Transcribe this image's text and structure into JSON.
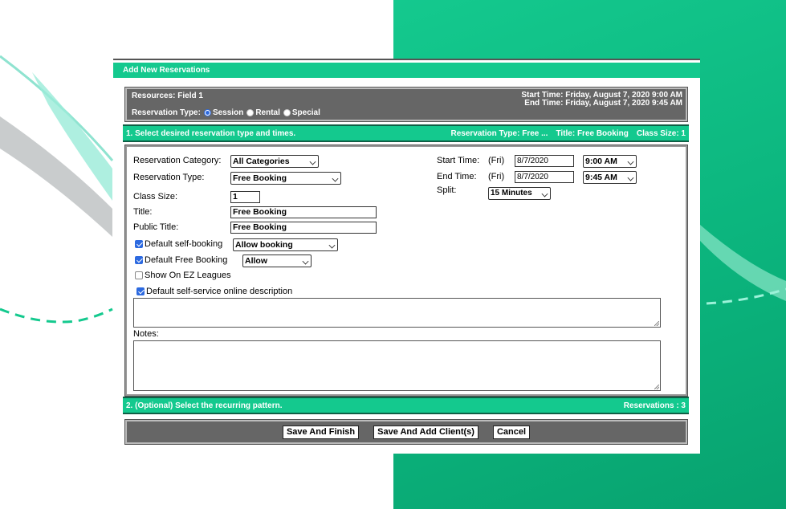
{
  "window": {
    "title": "Add New Reservations"
  },
  "header": {
    "resources": "Resources: Field 1",
    "start_time": "Start Time: Friday, August 7, 2020 9:00 AM",
    "end_time": "End Time: Friday, August 7, 2020 9:45 AM",
    "reservation_type_label": "Reservation Type:",
    "reservation_types": [
      {
        "label": "Session",
        "selected": true
      },
      {
        "label": "Rental",
        "selected": false
      },
      {
        "label": "Special",
        "selected": false
      }
    ]
  },
  "section1": {
    "title": "1. Select desired reservation type and times.",
    "reservation_type": "Reservation Type: Free ...",
    "title_info": "Title: Free Booking",
    "class_size": "Class Size: 1"
  },
  "form": {
    "reservation_category_label": "Reservation Category:",
    "reservation_category_value": "All Categories",
    "reservation_type_label": "Reservation Type:",
    "reservation_type_value": "Free Booking",
    "class_size_label": "Class Size:",
    "class_size_value": "1",
    "title_label": "Title:",
    "title_value": "Free Booking",
    "public_title_label": "Public Title:",
    "public_title_value": "Free Booking",
    "default_self_booking_label": "Default self-booking",
    "default_self_booking_checked": true,
    "default_self_booking_value": "Allow booking",
    "default_free_booking_label": "Default Free Booking",
    "default_free_booking_checked": true,
    "default_free_booking_value": "Allow",
    "show_ez_leagues_label": "Show On EZ Leagues",
    "show_ez_leagues_checked": false,
    "default_online_desc_label": "Default self-service online description",
    "default_online_desc_checked": true,
    "notes_label": "Notes:",
    "start_time_label": "Start Time:",
    "start_day": "(Fri)",
    "start_date": "8/7/2020",
    "start_time_value": "9:00 AM",
    "end_time_label": "End Time:",
    "end_day": "(Fri)",
    "end_date": "8/7/2020",
    "end_time_value": "9:45 AM",
    "split_label": "Split:",
    "split_value": "15 Minutes"
  },
  "section2": {
    "title": "2. (Optional) Select the recurring pattern.",
    "reservations": "Reservations : 3"
  },
  "buttons": {
    "save_finish": "Save And Finish",
    "save_add_client": "Save And Add Client(s)",
    "cancel": "Cancel"
  },
  "colors": {
    "accent_green": "#14c98e",
    "panel_gray": "#666666",
    "checkbox_blue": "#2d6ae0"
  }
}
